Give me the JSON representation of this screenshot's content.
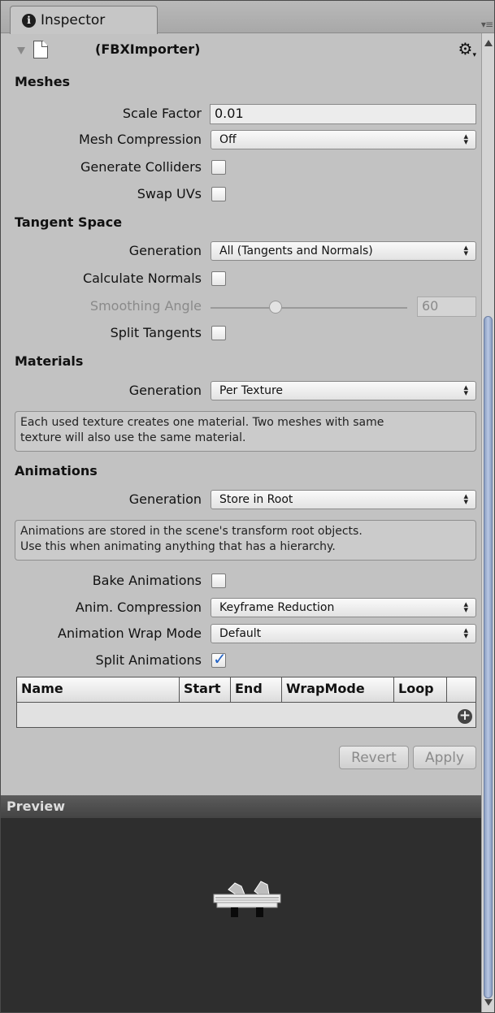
{
  "tab": {
    "label": "Inspector",
    "icon": "info-icon"
  },
  "header": {
    "title": "(FBXImporter)",
    "icon": "file-icon",
    "settings_icon": "gear-icon"
  },
  "meshes": {
    "section": "Meshes",
    "scale_factor_label": "Scale Factor",
    "scale_factor_value": "0.01",
    "mesh_compression_label": "Mesh Compression",
    "mesh_compression_value": "Off",
    "generate_colliders_label": "Generate Colliders",
    "generate_colliders_checked": false,
    "swap_uvs_label": "Swap UVs",
    "swap_uvs_checked": false
  },
  "tangent_space": {
    "section": "Tangent Space",
    "generation_label": "Generation",
    "generation_value": "All (Tangents and Normals)",
    "calculate_normals_label": "Calculate Normals",
    "calculate_normals_checked": false,
    "smoothing_angle_label": "Smoothing Angle",
    "smoothing_angle_value": "60",
    "smoothing_angle_fraction": 0.33,
    "split_tangents_label": "Split Tangents",
    "split_tangents_checked": false
  },
  "materials": {
    "section": "Materials",
    "generation_label": "Generation",
    "generation_value": "Per Texture",
    "help_line1": "Each used texture creates one material. Two meshes with same",
    "help_line2": "texture will also use the same material."
  },
  "animations": {
    "section": "Animations",
    "generation_label": "Generation",
    "generation_value": "Store in Root",
    "help_line1": "Animations are stored in the scene's transform root objects.",
    "help_line2": "Use this when animating anything that has a hierarchy.",
    "bake_label": "Bake Animations",
    "bake_checked": false,
    "compression_label": "Anim. Compression",
    "compression_value": "Keyframe Reduction",
    "wrap_mode_label": "Animation Wrap Mode",
    "wrap_mode_value": "Default",
    "split_label": "Split Animations",
    "split_checked": true
  },
  "split_table": {
    "columns": [
      "Name",
      "Start",
      "End",
      "WrapMode",
      "Loop"
    ],
    "add_icon": "plus-icon"
  },
  "buttons": {
    "revert": "Revert",
    "apply": "Apply"
  },
  "preview": {
    "label": "Preview"
  },
  "colors": {
    "panel": "#c2c2c2",
    "preview_bg": "#2e2e2e",
    "check_accent": "#2463c5"
  }
}
